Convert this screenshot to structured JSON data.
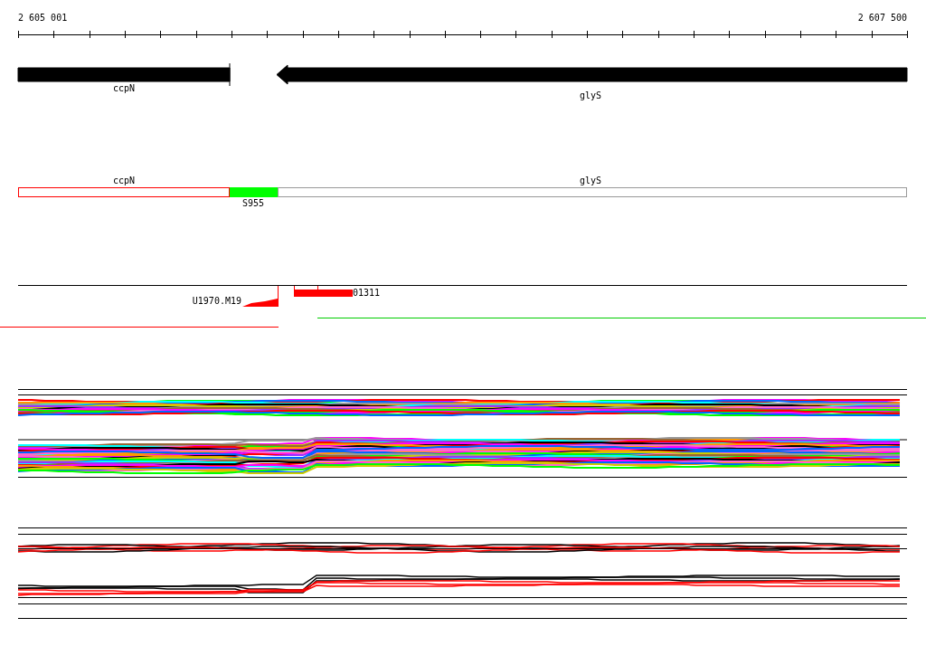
{
  "ruler": {
    "start_label": "2 605 001",
    "end_label": "2 607 500"
  },
  "genes": [
    {
      "name": "ccpN",
      "kind": "bar"
    },
    {
      "name": "glyS",
      "kind": "arrow-left"
    }
  ],
  "annotations": [
    {
      "name": "ccpN",
      "kind": "outline",
      "color": "#ff0000"
    },
    {
      "name": "S955",
      "kind": "filled",
      "color": "#00ff00"
    },
    {
      "name": "glyS",
      "kind": "outline",
      "color": "#999999"
    }
  ],
  "features": [
    {
      "name": "U1970.M19",
      "kind": "ramp"
    },
    {
      "name": "01311",
      "kind": "bar"
    }
  ]
}
